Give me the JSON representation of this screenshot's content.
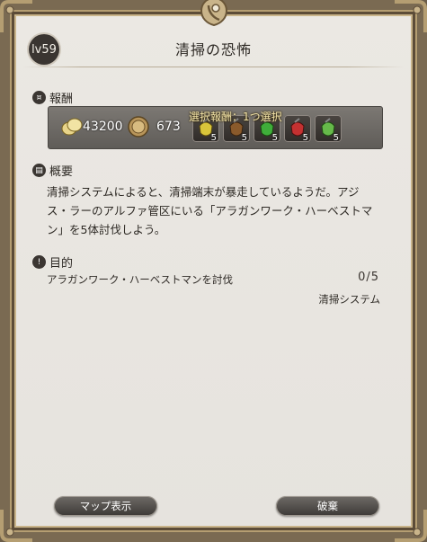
{
  "level_badge": "lv59",
  "title": "清掃の恐怖",
  "rewards": {
    "heading": "報酬",
    "gil": "43200",
    "seals": "673",
    "optional_label": "選択報酬：1つ選択",
    "items": [
      {
        "icon": "yellow-dye-icon",
        "qty": "5",
        "color": "#d9c53a"
      },
      {
        "icon": "brown-dye-icon",
        "qty": "5",
        "color": "#8a5a2b"
      },
      {
        "icon": "green-dye-icon",
        "qty": "5",
        "color": "#3fae3a"
      },
      {
        "icon": "red-dye-icon",
        "qty": "5",
        "color": "#c43131"
      },
      {
        "icon": "lime-dye-icon",
        "qty": "5",
        "color": "#66b94a"
      }
    ]
  },
  "summary": {
    "heading": "概要",
    "text": "清掃システムによると、清掃端末が暴走しているようだ。アジス・ラーのアルファ管区にいる「アラガンワーク・ハーベストマン」を5体討伐しよう。"
  },
  "objective": {
    "heading": "目的",
    "text": "アラガンワーク・ハーベストマンを討伐",
    "count": "0/5",
    "source": "清掃システム"
  },
  "buttons": {
    "map": "マップ表示",
    "abandon": "破棄"
  }
}
